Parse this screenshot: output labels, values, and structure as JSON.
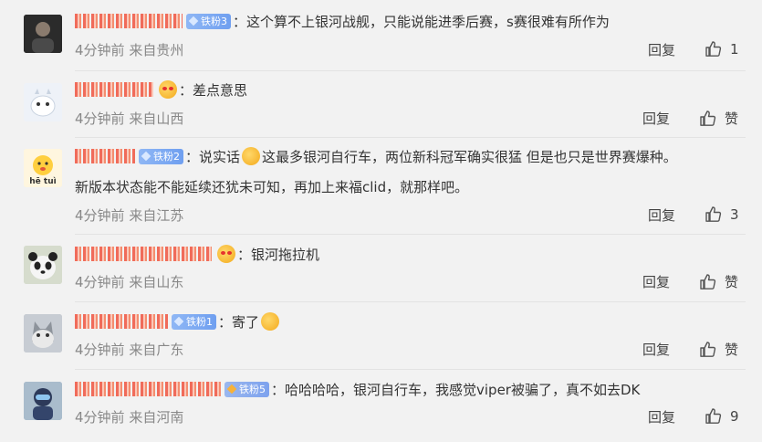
{
  "comments": [
    {
      "badge": "铁粉3",
      "text": "：这个算不上银河战舰，只能说能进季后赛，s赛很难有所作为",
      "time": "4分钟前",
      "location": "来自贵州",
      "reply_label": "回复",
      "like_label": "1",
      "avatar_color": "#3b3b3b"
    },
    {
      "badge": "",
      "text": "：差点意思",
      "time": "4分钟前",
      "location": "来自山西",
      "reply_label": "回复",
      "like_label": "赞",
      "avatar_color": "#e8eef6"
    },
    {
      "badge": "铁粉2",
      "text_a": "：说实话",
      "text_b": "这最多银河自行车，两位新科冠军确实很猛 但是也只是世界赛爆种。",
      "text2": "新版本状态能不能延续还犹未可知，再加上来福clid，就那样吧。",
      "time": "4分钟前",
      "location": "来自江苏",
      "reply_label": "回复",
      "like_label": "3",
      "avatar_color": "#fff1c9",
      "avatar_text": "hē tuì"
    },
    {
      "badge": "",
      "text": "：银河拖拉机",
      "time": "4分钟前",
      "location": "来自山东",
      "reply_label": "回复",
      "like_label": "赞",
      "avatar_color": "#cfd8c8"
    },
    {
      "badge": "铁粉1",
      "text": "：寄了",
      "time": "4分钟前",
      "location": "来自广东",
      "reply_label": "回复",
      "like_label": "赞",
      "avatar_color": "#b8bcc4"
    },
    {
      "badge": "铁粉5",
      "text": "：哈哈哈哈，银河自行车，我感觉viper被骗了，真不如去DK",
      "time": "4分钟前",
      "location": "来自河南",
      "reply_label": "回复",
      "like_label": "9",
      "avatar_color": "#9fb6c9"
    }
  ],
  "icons": {
    "like": "thumbs-up-icon",
    "fan_badge": "diamond-icon"
  },
  "colors": {
    "background": "#f2f2f2",
    "meta_text": "#888888",
    "badge_blue": "#7aa6f2",
    "nickname_red": "#f06b5a"
  }
}
